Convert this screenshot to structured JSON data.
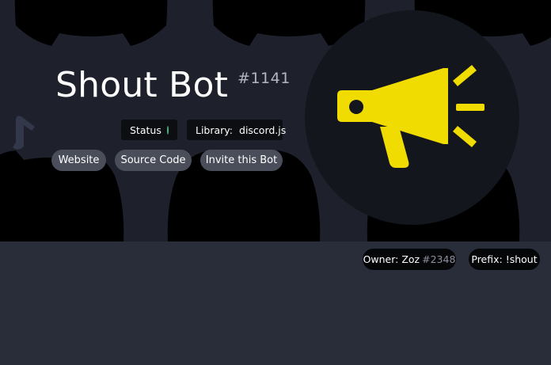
{
  "bot": {
    "name": "Shout Bot",
    "discriminator": "#1141"
  },
  "tags": {
    "status_label": "Status",
    "status_color": "#43b581",
    "library_label": "Library:",
    "library_value": "discord.js"
  },
  "links": {
    "website": "Website",
    "source_code": "Source Code",
    "invite": "Invite this Bot"
  },
  "meta": {
    "owner_label": "Owner: Zoz",
    "owner_tag": "#2348",
    "prefix_label": "Prefix: !shout"
  },
  "avatar": {
    "icon": "megaphone-icon",
    "icon_color": "#f0dc00"
  },
  "colors": {
    "page_background": "#292d3a",
    "hero_background": "#1e212c"
  }
}
